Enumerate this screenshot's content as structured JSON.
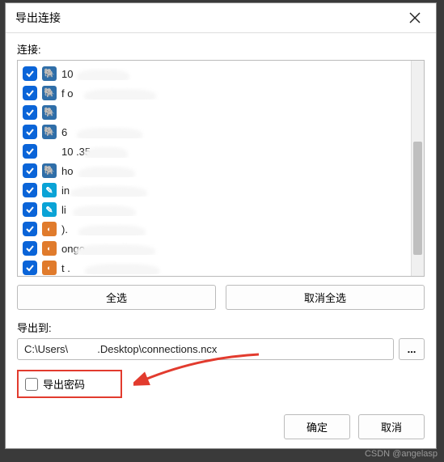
{
  "dialog": {
    "title": "导出连接"
  },
  "connections": {
    "label": "连接:",
    "items": [
      {
        "icon": "pg",
        "text": "  10"
      },
      {
        "icon": "pg",
        "text": "  f        o"
      },
      {
        "icon": "pg",
        "text": " "
      },
      {
        "icon": "pg",
        "text": " 6"
      },
      {
        "icon": "none",
        "text": "10         .35"
      },
      {
        "icon": "pg",
        "text": "  ho"
      },
      {
        "icon": "sq",
        "text": " in "
      },
      {
        "icon": "sq",
        "text": " li  "
      },
      {
        "icon": "mg",
        "text": ")."
      },
      {
        "icon": "mg",
        "text": "    ongo"
      },
      {
        "icon": "mg",
        "text": "t  ."
      }
    ]
  },
  "buttons": {
    "select_all": "全选",
    "deselect_all": "取消全选",
    "browse": "...",
    "ok": "确定",
    "cancel": "取消"
  },
  "export_to": {
    "label": "导出到:",
    "path": "C:\\Users\\          .Desktop\\connections.ncx"
  },
  "export_password": {
    "label": "导出密码",
    "checked": false
  },
  "watermark": "CSDN @angelasp"
}
